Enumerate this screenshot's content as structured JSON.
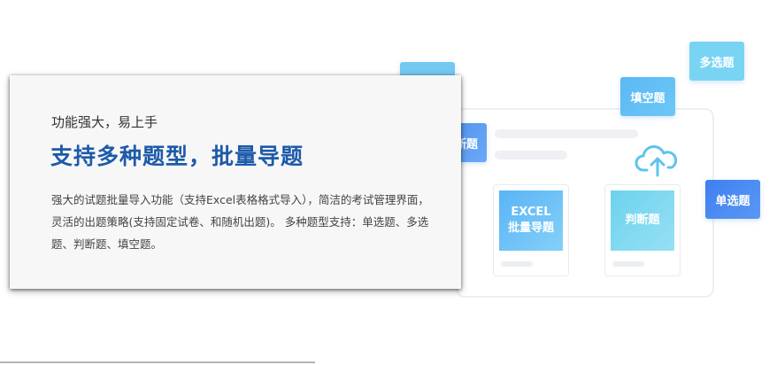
{
  "colors": {
    "headline": "#1d5aa9",
    "tag_blue": "#4a8ef0",
    "tag_light": "#62c3f0",
    "excel_gradient": [
      "#5ab4f5",
      "#84d0f8"
    ],
    "judge_gradient": [
      "#6cd2ee",
      "#97e0f4"
    ]
  },
  "card": {
    "subtitle": "功能强大，易上手",
    "headline": "支持多种题型，批量导题",
    "description": "强大的试题批量导入功能（支持Excel表格格式导入），简洁的考试管理界面，灵活的出题策略(支持固定试卷、和随机出题)。 多种题型支持：单选题、多选题、判断题、填空题。"
  },
  "illustration": {
    "tags": {
      "multi": "多选题",
      "fill": "填空题",
      "single": "单选题",
      "judge_partial": "断题"
    },
    "excel_card": {
      "line1": "EXCEL",
      "line2": "批量导题"
    },
    "judge_card": {
      "label": "判断题"
    },
    "upload_icon": "cloud-upload-icon"
  }
}
